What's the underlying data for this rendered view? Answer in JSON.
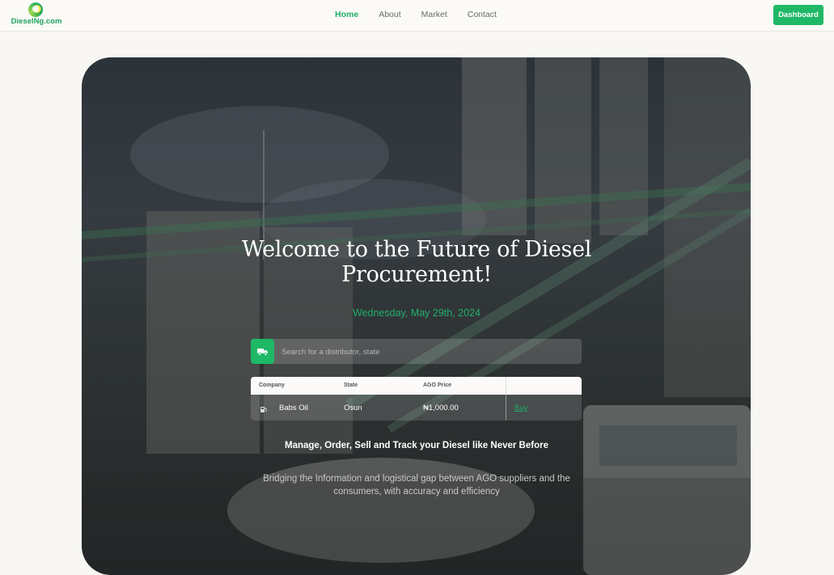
{
  "brand": {
    "name": "DieselNg.com"
  },
  "nav": {
    "links": [
      {
        "label": "Home",
        "active": true
      },
      {
        "label": "About",
        "active": false
      },
      {
        "label": "Market",
        "active": false
      },
      {
        "label": "Contact",
        "active": false
      }
    ],
    "dashboard_label": "Dashboard"
  },
  "hero": {
    "title": "Welcome to the Future of Diesel Procurement!",
    "date": "Wednesday, May 29th, 2024",
    "search": {
      "placeholder": "Search for a distributor, state",
      "value": ""
    },
    "table": {
      "headers": [
        "Company",
        "State",
        "AGO Price"
      ],
      "rows": [
        {
          "company": "Babs Oil",
          "state": "Osun",
          "price": "₦1,000.00",
          "action": "Buy"
        }
      ]
    },
    "tagline": "Manage, Order, Sell and Track your Diesel like Never Before",
    "description": "Bridging the Information and logistical gap between AGO suppliers and the consumers, with accuracy and efficiency"
  },
  "colors": {
    "accent": "#1fb866",
    "brand_text": "#20a463",
    "background": "#f8f7f3"
  },
  "icons": {
    "search": "fuel-truck-icon",
    "row": "fuel-pump-icon"
  }
}
